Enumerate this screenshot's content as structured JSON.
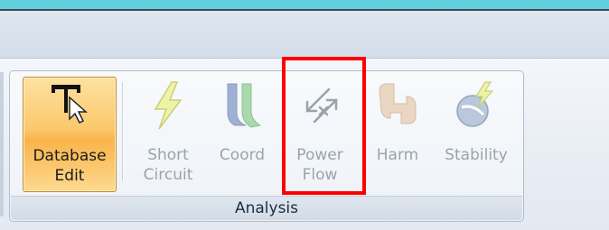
{
  "ribbon": {
    "group_label": "Analysis",
    "buttons": [
      {
        "line1": "Database",
        "line2": "Edit",
        "icon": "database-edit-cursor-icon",
        "state": "active"
      },
      {
        "line1": "Short",
        "line2": "Circuit",
        "icon": "lightning-bolt-icon",
        "state": "disabled"
      },
      {
        "line1": "Coord",
        "line2": "",
        "icon": "coordination-curves-icon",
        "state": "disabled"
      },
      {
        "line1": "Power",
        "line2": "Flow",
        "icon": "power-flow-arrows-icon",
        "state": "disabled"
      },
      {
        "line1": "Harm",
        "line2": "",
        "icon": "harmonics-waveform-icon",
        "state": "disabled"
      },
      {
        "line1": "Stability",
        "line2": "",
        "icon": "stability-globe-bolt-icon",
        "state": "disabled"
      }
    ]
  },
  "colors": {
    "highlight": "#ff0000",
    "active_button": "#f9b44b",
    "disabled_text": "#9aa3ad"
  }
}
